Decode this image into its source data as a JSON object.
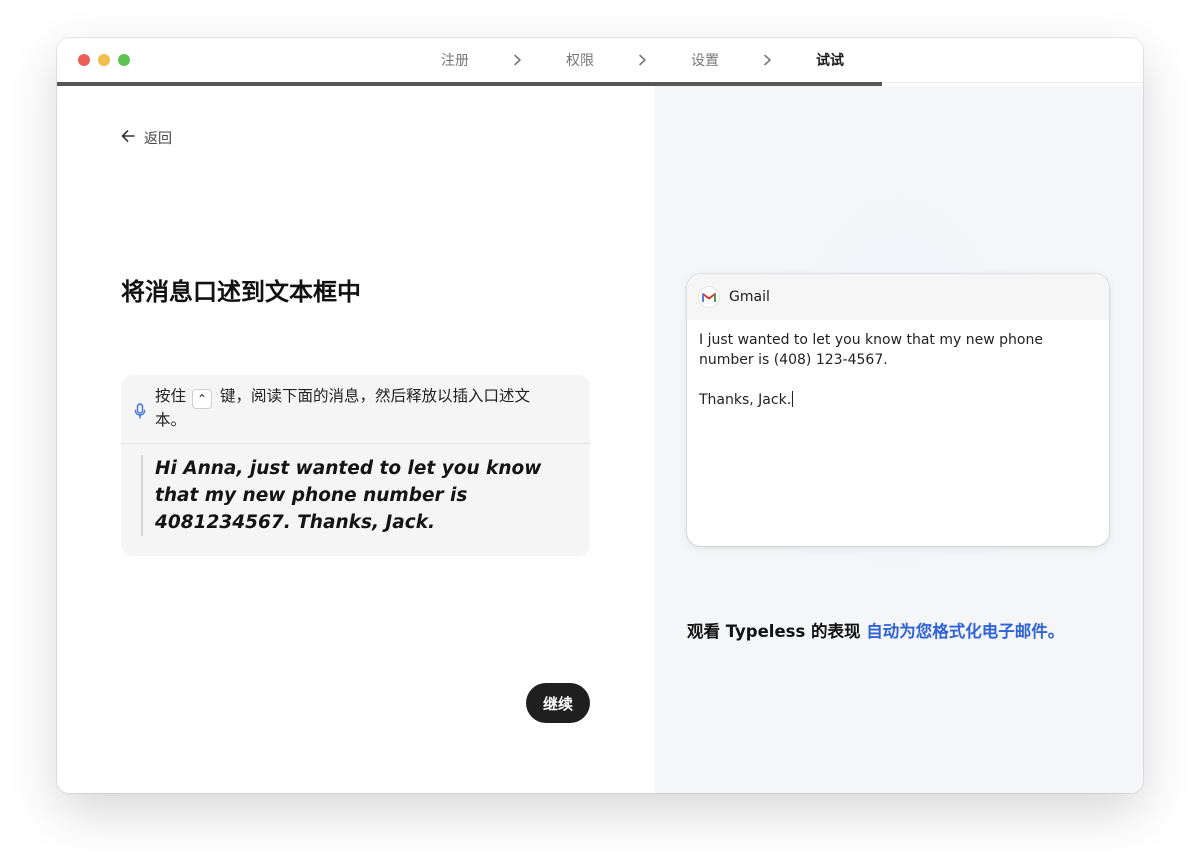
{
  "titlebar": {
    "steps": [
      {
        "label": "注册",
        "state": "done"
      },
      {
        "label": "权限",
        "state": "done"
      },
      {
        "label": "设置",
        "state": "done"
      },
      {
        "label": "试试",
        "state": "active"
      }
    ]
  },
  "progress": {
    "fraction": 0.76
  },
  "left": {
    "back_label": "返回",
    "heading": "将消息口述到文本框中",
    "instruction": {
      "before_key": "按住",
      "key_symbol": "⌃",
      "after_key": "键，阅读下面的消息，然后释放以插入口述文本。"
    },
    "message": "Hi Anna, just wanted to let you know that my new phone number is 4081234567. Thanks, Jack.",
    "continue_label": "继续"
  },
  "right": {
    "app_name": "Gmail",
    "email_lines": [
      "I just wanted to let you know that my new phone number is (408) 123-4567.",
      "Thanks, Jack."
    ],
    "caption_prefix": "观看 Typeless 的表现 ",
    "caption_highlight": "自动为您格式化电子邮件。"
  },
  "colors": {
    "accent_blue": "#2f63d6",
    "button_dark": "#1f1f1f",
    "panel_bg": "#f5f6f8"
  },
  "icons": [
    "back-arrow-icon",
    "chevron-right-icon",
    "microphone-icon",
    "gmail-icon"
  ]
}
